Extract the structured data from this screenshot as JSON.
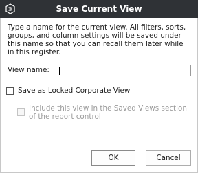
{
  "dialog": {
    "title": "Save Current View",
    "app_icon": "app-logo-icon"
  },
  "instructions": "Type a name for the current view.  All filters, sorts, groups, and column settings will be saved under this name so that you can recall them later while in this register.",
  "view_name": {
    "label": "View name:",
    "value": "",
    "focused": true
  },
  "locked_option": {
    "label": "Save as Locked Corporate View",
    "checked": false
  },
  "include_option": {
    "label": "Include this view in the Saved Views section of the report control",
    "checked": false,
    "disabled": true
  },
  "buttons": {
    "ok_label": "OK",
    "cancel_label": "Cancel"
  },
  "colors": {
    "titlebar_bg": "#2f3236",
    "disabled_text": "#9a9a9a"
  }
}
